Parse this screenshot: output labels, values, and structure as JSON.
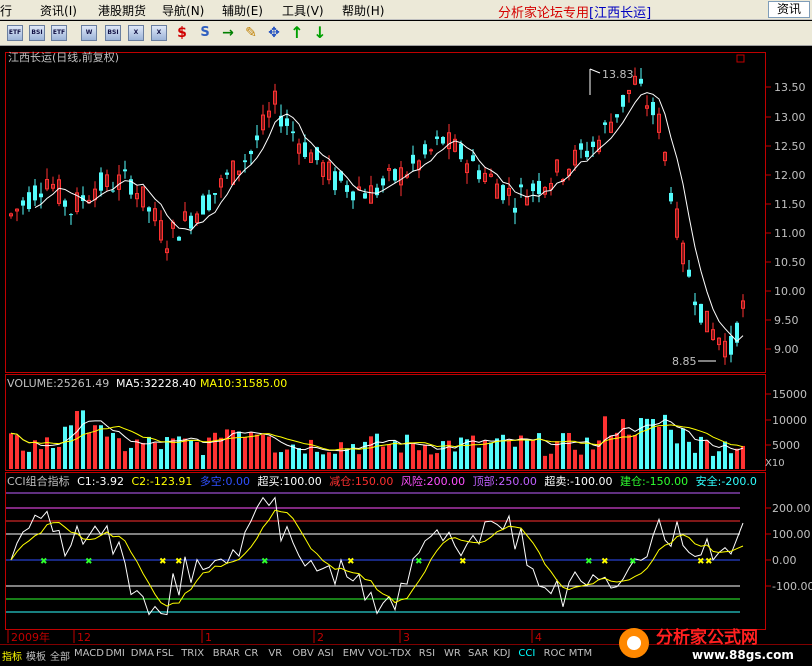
{
  "menu": {
    "items": [
      "行",
      "资讯",
      "港股期货",
      "导航",
      "辅助",
      "工具",
      "帮助"
    ],
    "items_keys": [
      "",
      "(I)",
      "",
      "(N)",
      "(E)",
      "(V)",
      "(H)"
    ],
    "title": "分析家论坛专用",
    "stock_tag": "[江西长运]",
    "right_button": "资讯"
  },
  "toolbar": {
    "buttons": [
      "ETF",
      "BSI",
      "ETF",
      "W",
      "X",
      "$",
      "S",
      "→",
      "✎",
      "✥",
      "↑",
      "↓"
    ]
  },
  "main_chart": {
    "title": "江西长运(日线,前复权)",
    "high_label": "13.83",
    "low_label": "8.85",
    "y_ticks": [
      "13.50",
      "13.00",
      "12.50",
      "12.00",
      "11.50",
      "11.00",
      "10.50",
      "10.00",
      "9.50",
      "9.00"
    ],
    "colors": {
      "up": "#ff3232",
      "down": "#54fcfc",
      "axis": "#c00000",
      "ma": "#ffff00"
    }
  },
  "volume_chart": {
    "label": "VOLUME:",
    "value": "25261.49",
    "ma5_label": "MA5:",
    "ma5": "32228.40",
    "ma10_label": "MA10:",
    "ma10": "31585.00",
    "y_ticks": [
      "15000",
      "10000",
      "5000"
    ],
    "unit": "X10"
  },
  "cci_chart": {
    "name": "CCI组合指标",
    "c1": "C1:-3.92",
    "c2": "C2:-123.91",
    "duokong": "多空:0.00",
    "chaomai": "超买:100.00",
    "jiancang": "减仓:150.00",
    "fengxian": "风险:200.00",
    "dingbu": "顶部:250.00",
    "chaomai2": "超卖:-100.00",
    "jiancang2": "建仓:-150.00",
    "anquan": "安全:-200.0",
    "y_ticks": [
      "200.00",
      "100.00",
      "0.00",
      "-100.00"
    ]
  },
  "time_axis": {
    "labels": [
      "2009年",
      "12",
      "1",
      "2",
      "3",
      "4"
    ]
  },
  "tabs": [
    "指标",
    "模板",
    "全部",
    "MACD",
    "DMI",
    "DMA",
    "FSL",
    "TRIX",
    "BRAR",
    "CR",
    "VR",
    "OBV",
    "ASI",
    "EMV",
    "VOL-TDX",
    "RSI",
    "WR",
    "SAR",
    "KDJ",
    "CCI",
    "ROC",
    "MTM"
  ],
  "watermark": {
    "title": "分析家公式网",
    "url": "www.88gs.com"
  }
}
